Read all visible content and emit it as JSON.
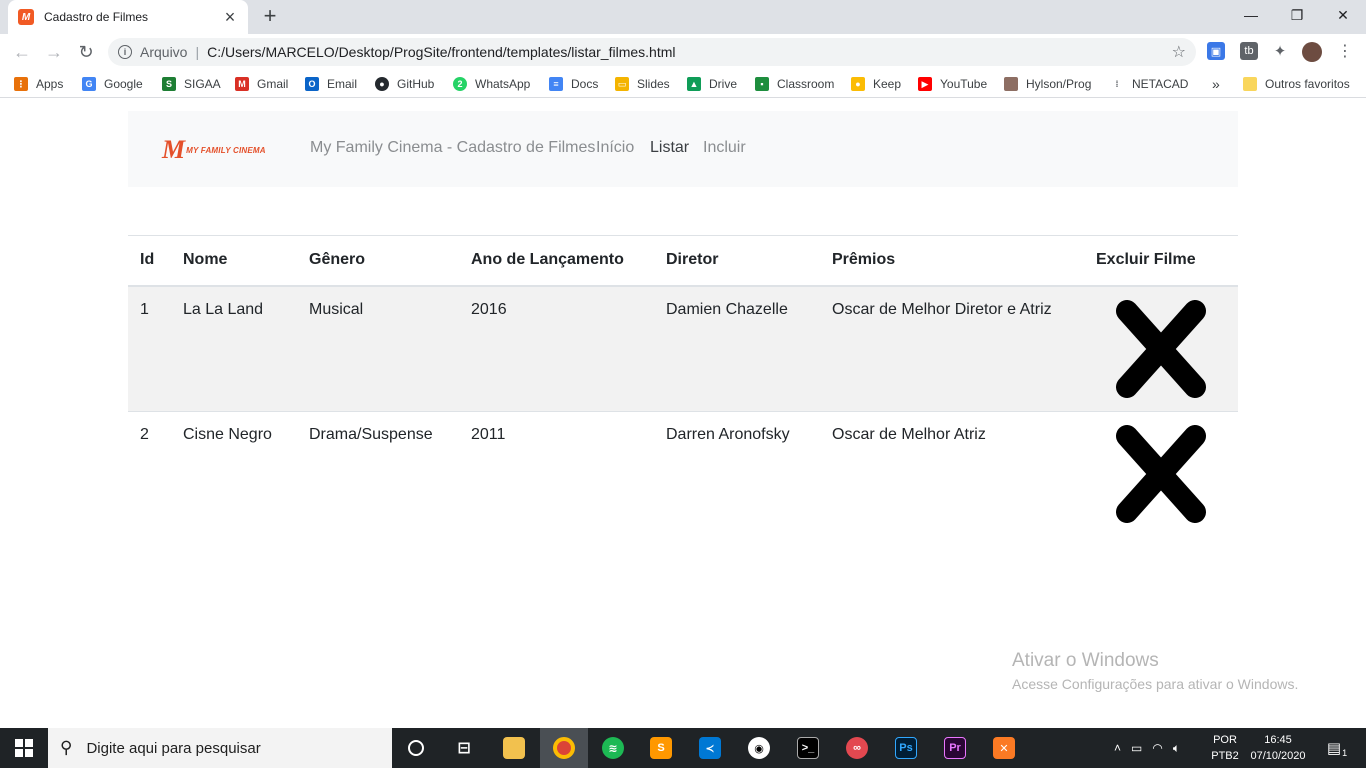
{
  "browser": {
    "tab_title": "Cadastro de Filmes",
    "tab_favicon": "M",
    "new_tab": "+",
    "scheme": "Arquivo",
    "separator": "|",
    "url": "C:/Users/MARCELO/Desktop/ProgSite/frontend/templates/listar_filmes.html",
    "window_controls": {
      "minimize": "—",
      "maximize": "❐",
      "close": "✕"
    }
  },
  "bookmarks": [
    {
      "label": "Apps",
      "icon": "apps-grid-icon",
      "color": "#e8710a"
    },
    {
      "label": "Google",
      "icon": "google-icon",
      "color": "#4285f4"
    },
    {
      "label": "SIGAA",
      "icon": "sigaa-icon",
      "color": "#1e7e34"
    },
    {
      "label": "Gmail",
      "icon": "gmail-icon",
      "color": "#d93025"
    },
    {
      "label": "Email",
      "icon": "outlook-icon",
      "color": "#0a64c8"
    },
    {
      "label": "GitHub",
      "icon": "github-icon",
      "color": "#24292e"
    },
    {
      "label": "WhatsApp",
      "icon": "whatsapp-icon",
      "color": "#25d366"
    },
    {
      "label": "Docs",
      "icon": "docs-icon",
      "color": "#4285f4"
    },
    {
      "label": "Slides",
      "icon": "slides-icon",
      "color": "#f4b400"
    },
    {
      "label": "Drive",
      "icon": "drive-icon",
      "color": "#0f9d58"
    },
    {
      "label": "Classroom",
      "icon": "classroom-icon",
      "color": "#1e8e3e"
    },
    {
      "label": "Keep",
      "icon": "keep-icon",
      "color": "#fbbc04"
    },
    {
      "label": "YouTube",
      "icon": "youtube-icon",
      "color": "#ff0000"
    },
    {
      "label": "Hylson/Prog",
      "icon": "avatar-icon",
      "color": "#8d6e63"
    },
    {
      "label": "NETACAD",
      "icon": "cisco-icon",
      "color": "#5f6368"
    }
  ],
  "bookmarks_more": "»",
  "other_bookmarks": "Outros favoritos",
  "site": {
    "brand_text": "MY FAMILY CINEMA",
    "brand_m": "M",
    "title": "My Family Cinema - Cadastro de Filmes",
    "nav": {
      "home": "Início",
      "list": "Listar",
      "add": "Incluir"
    }
  },
  "table": {
    "headers": {
      "id": "Id",
      "name": "Nome",
      "genre": "Gênero",
      "year": "Ano de Lançamento",
      "director": "Diretor",
      "awards": "Prêmios",
      "delete": "Excluir Filme"
    },
    "rows": [
      {
        "id": "1",
        "name": "La La Land",
        "genre": "Musical",
        "year": "2016",
        "director": "Damien Chazelle",
        "awards": "Oscar de Melhor Diretor e Atriz"
      },
      {
        "id": "2",
        "name": "Cisne Negro",
        "genre": "Drama/Suspense",
        "year": "2011",
        "director": "Darren Aronofsky",
        "awards": "Oscar de Melhor Atriz"
      }
    ]
  },
  "watermark": {
    "title": "Ativar o Windows",
    "subtitle": "Acesse Configurações para ativar o Windows."
  },
  "taskbar": {
    "search_placeholder": "Digite aqui para pesquisar",
    "lang_top": "POR",
    "lang_bottom": "PTB2",
    "time": "16:45",
    "date": "07/10/2020",
    "notifications": "1"
  }
}
